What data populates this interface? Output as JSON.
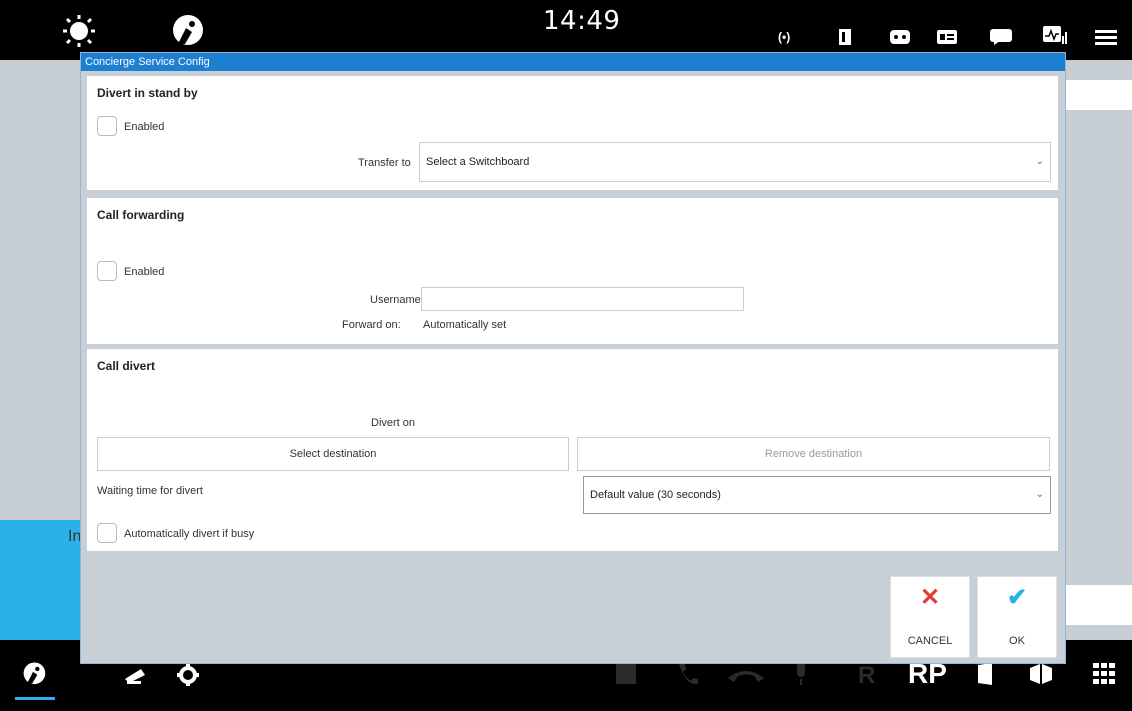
{
  "statusbar": {
    "time": "14:49"
  },
  "dialog": {
    "title": "Concierge Service Config",
    "divert_standby": {
      "title": "Divert in stand by",
      "enabled_label": "Enabled",
      "transfer_label": "Transfer to",
      "transfer_value": "Select a Switchboard"
    },
    "call_forwarding": {
      "title": "Call forwarding",
      "enabled_label": "Enabled",
      "username_label": "Username",
      "username_value": "",
      "forward_on_label": "Forward on:",
      "forward_on_value": "Automatically set"
    },
    "call_divert": {
      "title": "Call divert",
      "divert_on_label": "Divert on",
      "select_destination": "Select destination",
      "remove_destination": "Remove destination",
      "waiting_label": "Waiting time for divert",
      "waiting_value": "Default value (30 seconds)",
      "auto_divert_label": "Automatically divert if busy"
    },
    "buttons": {
      "cancel": "CANCEL",
      "ok": "OK"
    }
  },
  "bottombar": {
    "rp_label": "RP",
    "r_label": "R"
  },
  "background": {
    "blue_text": "In"
  },
  "colors": {
    "accent": "#29b2ea",
    "cancel": "#e53935",
    "ok": "#29b2ea",
    "title_bar": "#1d7fd0"
  }
}
